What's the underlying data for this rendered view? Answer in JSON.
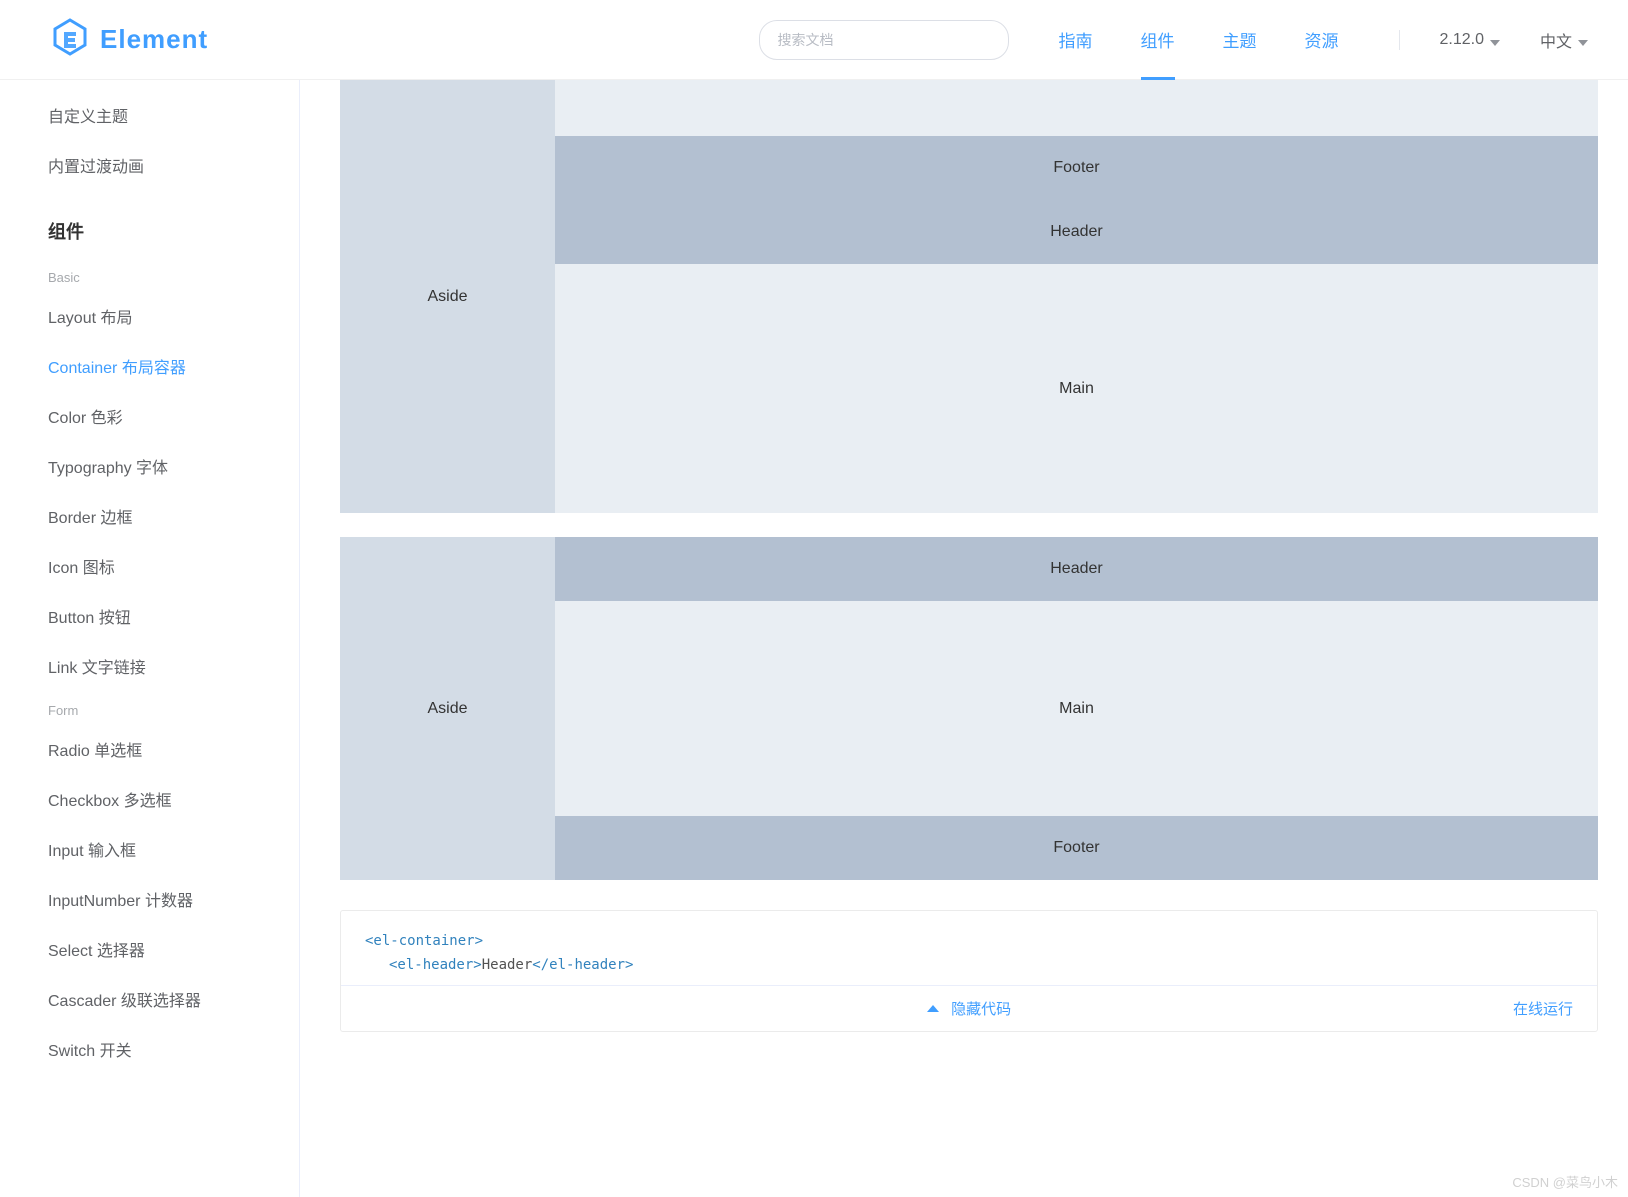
{
  "header": {
    "logo_text": "Element",
    "search_placeholder": "搜索文档",
    "nav": [
      "指南",
      "组件",
      "主题",
      "资源"
    ],
    "active_nav_index": 1,
    "version": "2.12.0",
    "lang": "中文"
  },
  "sidebar": {
    "top_items": [
      "自定义主题",
      "内置过渡动画"
    ],
    "group_title": "组件",
    "groups": [
      {
        "sub": "Basic",
        "items": [
          "Layout 布局",
          "Container 布局容器",
          "Color 色彩",
          "Typography 字体",
          "Border 边框",
          "Icon 图标",
          "Button 按钮",
          "Link 文字链接"
        ],
        "active_index": 1
      },
      {
        "sub": "Form",
        "items": [
          "Radio 单选框",
          "Checkbox 多选框",
          "Input 输入框",
          "InputNumber 计数器",
          "Select 选择器",
          "Cascader 级联选择器",
          "Switch 开关"
        ],
        "active_index": -1
      }
    ]
  },
  "demo": {
    "labels": {
      "aside": "Aside",
      "header": "Header",
      "main": "Main",
      "footer": "Footer"
    }
  },
  "code": {
    "line1_open": "<el-container>",
    "line2_open": "<el-header>",
    "line2_text": "Header",
    "line2_close": "</el-header>",
    "hide_code": "隐藏代码",
    "online_run": "在线运行"
  },
  "watermark": "CSDN @菜鸟小木"
}
